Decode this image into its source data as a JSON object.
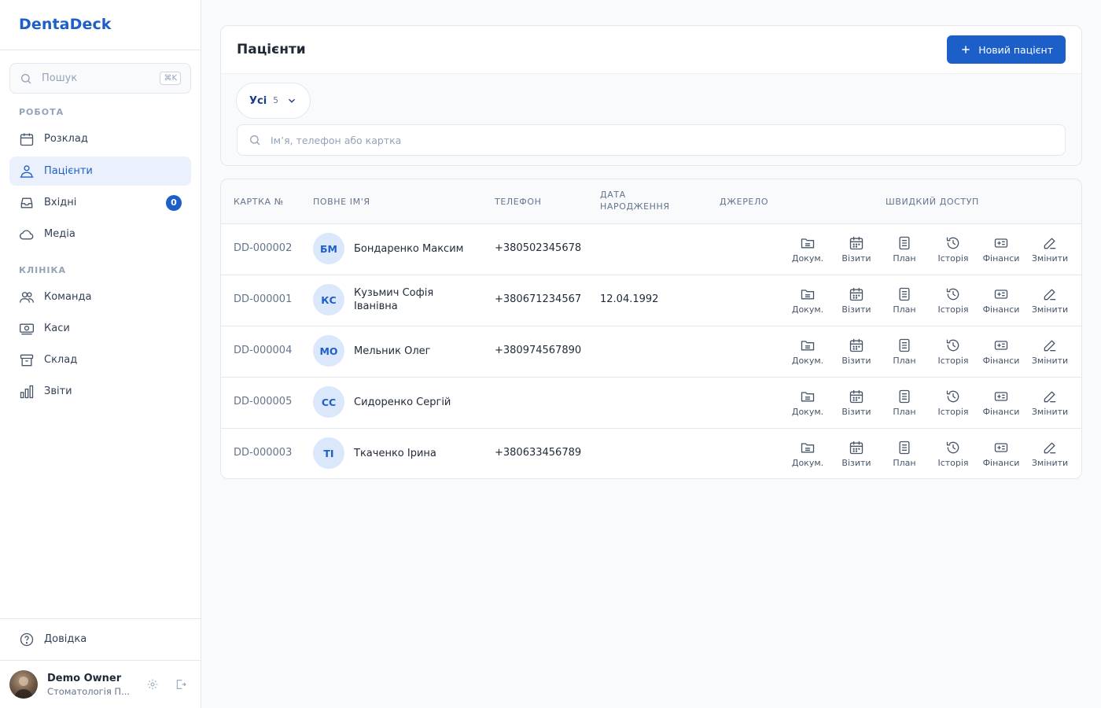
{
  "app": {
    "name": "DentaDeck"
  },
  "sidebar": {
    "search_placeholder": "Пошук",
    "search_shortcut": "⌘K",
    "sections": [
      {
        "title": "РОБОТА"
      },
      {
        "title": "КЛІНІКА"
      }
    ],
    "items": [
      {
        "label": "Розклад",
        "icon": "calendar-icon"
      },
      {
        "label": "Пацієнти",
        "icon": "users-icon",
        "active": true
      },
      {
        "label": "Вхідні",
        "icon": "inbox-icon",
        "badge": "0"
      },
      {
        "label": "Медіа",
        "icon": "cloud-icon"
      },
      {
        "label": "Команда",
        "icon": "team-icon"
      },
      {
        "label": "Каси",
        "icon": "cash-icon"
      },
      {
        "label": "Склад",
        "icon": "archive-icon"
      },
      {
        "label": "Звіти",
        "icon": "bar-chart-icon"
      }
    ],
    "help_label": "Довідка",
    "user": {
      "name": "Demo Owner",
      "org": "Стоматологія П..."
    }
  },
  "page": {
    "title": "Пацієнти",
    "new_button": "Новий пацієнт",
    "filter": {
      "label": "Усі",
      "count": "5"
    },
    "search_placeholder": "Ім’я, телефон або картка"
  },
  "table": {
    "headers": {
      "card": "КАРТКА №",
      "name": "ПОВНЕ ІМ'Я",
      "phone": "ТЕЛЕФОН",
      "dob_line1": "ДАТА",
      "dob_line2": "НАРОДЖЕННЯ",
      "source": "ДЖЕРЕЛО",
      "quick": "ШВИДКИЙ ДОСТУП"
    },
    "quick_actions": [
      "Докум.",
      "Візити",
      "План",
      "Історія",
      "Фінанси",
      "Змінити"
    ],
    "rows": [
      {
        "card": "DD-000002",
        "initials": "БМ",
        "name": "Бондаренко Максим",
        "phone": "+380502345678",
        "dob": ""
      },
      {
        "card": "DD-000001",
        "initials": "КС",
        "name": "Кузьмич Софія Іванівна",
        "phone": "+380671234567",
        "dob": "12.04.1992"
      },
      {
        "card": "DD-000004",
        "initials": "МО",
        "name": "Мельник Олег",
        "phone": "+380974567890",
        "dob": ""
      },
      {
        "card": "DD-000005",
        "initials": "СС",
        "name": "Сидоренко Сергій",
        "phone": "",
        "dob": ""
      },
      {
        "card": "DD-000003",
        "initials": "ТІ",
        "name": "Ткаченко Ірина",
        "phone": "+380633456789",
        "dob": ""
      }
    ]
  },
  "colors": {
    "accent": "#1d5fc9",
    "active_bg": "#eaf1fd",
    "avatar_bg": "#dbe7fb"
  }
}
